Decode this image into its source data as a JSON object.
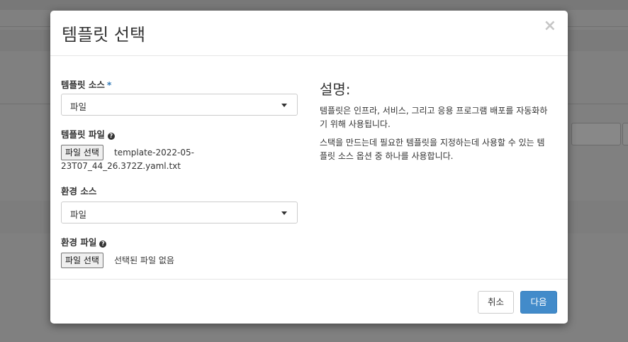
{
  "modal": {
    "title": "템플릿 선택",
    "close_symbol": "×"
  },
  "form": {
    "template_source": {
      "label": "템플릿 소스",
      "required_mark": "*",
      "selected": "파일"
    },
    "template_file": {
      "label": "템플릿 파일",
      "button_label": "파일 선택",
      "file_name_line1": "template-2022-05-",
      "file_name_line2": "23T07_44_26.372Z.yaml.txt"
    },
    "env_source": {
      "label": "환경 소스",
      "selected": "파일"
    },
    "env_file": {
      "label": "환경 파일",
      "button_label": "파일 선택",
      "status": "선택된 파일 없음"
    }
  },
  "description": {
    "title": "설명:",
    "paragraph1": "템플릿은 인프라, 서비스, 그리고 응용 프로그램 배포를 자동화하기 위해 사용됩니다.",
    "paragraph2": "스택을 만드는데 필요한 템플릿을 지정하는데 사용할 수 있는 템플릿 소스 옵션 중 하나를 사용합니다."
  },
  "footer": {
    "cancel_label": "취소",
    "next_label": "다음"
  },
  "colors": {
    "primary": "#428bca",
    "required": "#337ab7",
    "overlay": "#808080"
  }
}
